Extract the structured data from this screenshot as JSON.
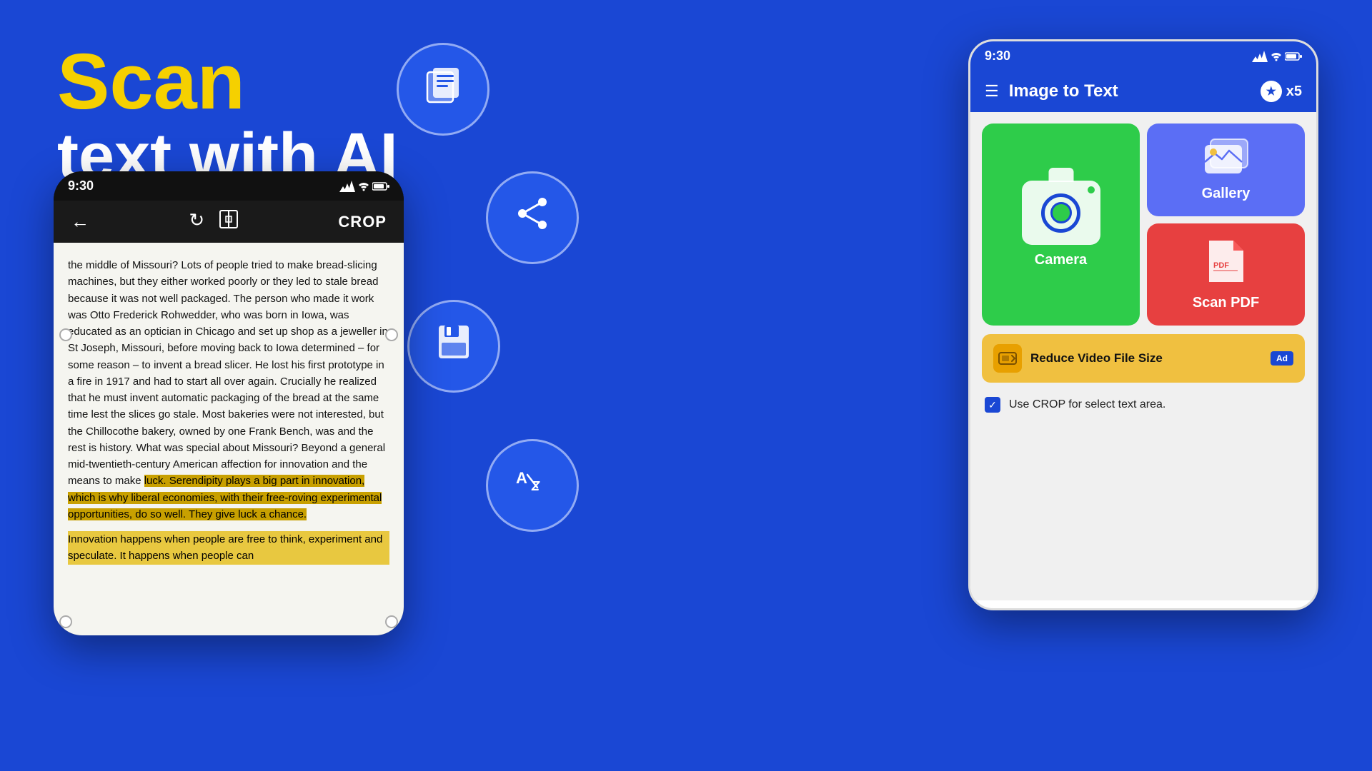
{
  "background_color": "#1a47d4",
  "hero": {
    "scan_label": "Scan",
    "subtitle": "text with AI"
  },
  "floating_circles": [
    {
      "id": "docs",
      "icon": "📋"
    },
    {
      "id": "share",
      "icon": "🔗"
    },
    {
      "id": "save",
      "icon": "💾"
    },
    {
      "id": "translate",
      "icon": "🔤"
    }
  ],
  "phone_left": {
    "status_time": "9:30",
    "toolbar": {
      "back_icon": "←",
      "rotate_icon": "↻",
      "crop_toggle_icon": "⊞",
      "crop_label": "CROP"
    },
    "body_text": "the middle of Missouri? Lots of people tried to make bread-slicing machines, but they either worked poorly or they led to stale bread because it was not well packaged. The person who made it work was Otto Frederick Rohwedder, who was born in Iowa, was educated as an optician in Chicago and set up shop as a jeweller in St Joseph, Missouri, before moving back to Iowa determined – for some reason – to invent a bread slicer. He lost his first prototype in a fire in 1917 and had to start all over again. Crucially he realized that he must invent automatic packaging of the bread at the same time lest the slices go stale. Most bakeries were not interested, but the Chillocothe bakery, owned by one Frank Bench, was and the rest is history. What was special about Missouri? Beyond a general mid-twentieth-century American affection for innovation and the means to make luck. Serendipity plays a big part in innovation, which is why liberal economies, with their free-roving experimental opportunities, do so well. They give luck a chance.",
    "highlighted_text": "Innovation happens when people are free to think, experiment and speculate. It happens when people can"
  },
  "phone_right": {
    "status_time": "9:30",
    "header": {
      "menu_icon": "☰",
      "title": "Image to Text",
      "premium_label": "x5"
    },
    "buttons": {
      "camera_label": "Camera",
      "gallery_label": "Gallery",
      "pdf_label": "Scan PDF"
    },
    "ad_banner": {
      "text": "Reduce Video File Size",
      "badge": "Ad"
    },
    "crop_checkbox": {
      "checked": true,
      "label": "Use CROP for select text area."
    }
  }
}
